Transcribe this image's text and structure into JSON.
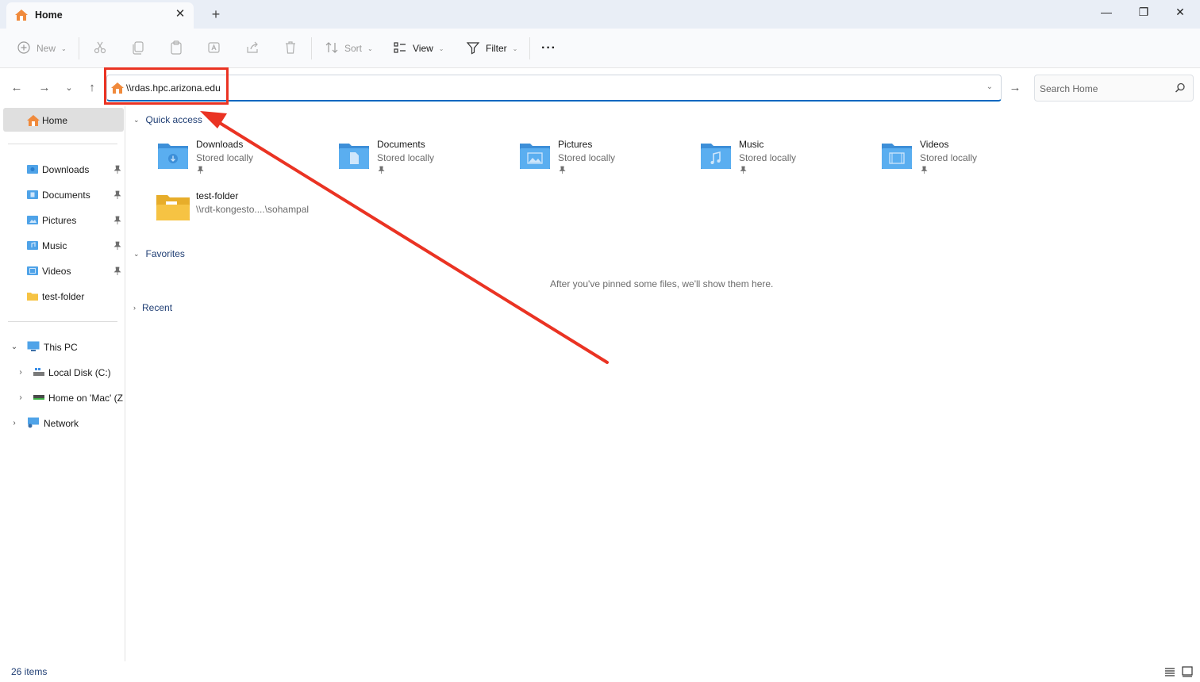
{
  "window": {
    "tab_title": "Home",
    "tab_close": "✕",
    "new_tab": "+",
    "minimize": "—",
    "maximize": "❐",
    "close": "✕"
  },
  "toolbar": {
    "new_label": "New",
    "sort_label": "Sort",
    "view_label": "View",
    "filter_label": "Filter",
    "more_label": "···"
  },
  "navigation": {
    "address_value": "\\\\rdas.hpc.arizona.edu",
    "search_placeholder": "Search Home"
  },
  "sidebar": {
    "home": "Home",
    "pinned": [
      {
        "label": "Downloads",
        "icon": "downloads-folder-icon"
      },
      {
        "label": "Documents",
        "icon": "documents-folder-icon"
      },
      {
        "label": "Pictures",
        "icon": "pictures-folder-icon"
      },
      {
        "label": "Music",
        "icon": "music-folder-icon"
      },
      {
        "label": "Videos",
        "icon": "videos-folder-icon"
      },
      {
        "label": "test-folder",
        "icon": "folder-icon"
      }
    ],
    "this_pc": "This PC",
    "drives": [
      {
        "label": "Local Disk (C:)"
      },
      {
        "label": "Home on 'Mac' (Z"
      }
    ],
    "network": "Network"
  },
  "content": {
    "quick_access_title": "Quick access",
    "quick_access": [
      {
        "name": "Downloads",
        "sub": "Stored locally"
      },
      {
        "name": "Documents",
        "sub": "Stored locally"
      },
      {
        "name": "Pictures",
        "sub": "Stored locally"
      },
      {
        "name": "Music",
        "sub": "Stored locally"
      },
      {
        "name": "Videos",
        "sub": "Stored locally"
      },
      {
        "name": "test-folder",
        "sub": "\\\\rdt-kongesto....\\sohampal"
      }
    ],
    "favorites_title": "Favorites",
    "favorites_empty": "After you've pinned some files, we'll show them here.",
    "recent_title": "Recent"
  },
  "status": {
    "item_count": "26 items"
  },
  "colors": {
    "accent": "#0067c0",
    "annotation": "#ea3323",
    "folder_blue": "#4fa3e8",
    "folder_yellow": "#f6c343"
  }
}
